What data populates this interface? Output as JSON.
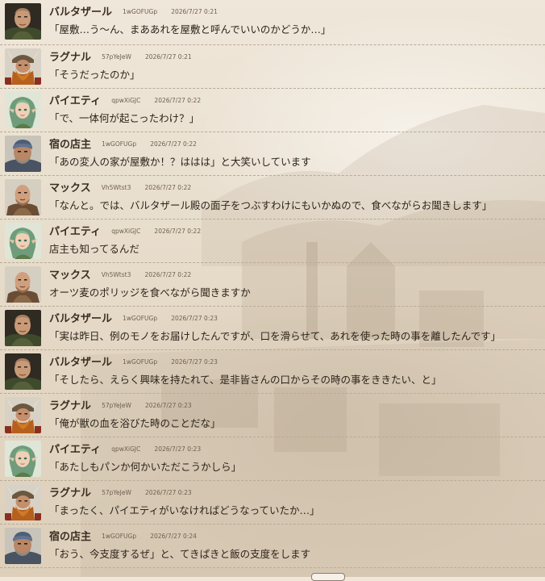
{
  "messages": [
    {
      "name": "バルタザール",
      "uid": "1wGOFUGp",
      "time": "2026/7/27 0:21",
      "text": "「屋敷…う～ん、まああれを屋敷と呼んでいいのかどうか…」",
      "avatar": "baltazar"
    },
    {
      "name": "ラグナル",
      "uid": "57pYeJeW",
      "time": "2026/7/27 0:21",
      "text": "「そうだったのか」",
      "avatar": "ragnar"
    },
    {
      "name": "パイエティ",
      "uid": "qpwXiGJC",
      "time": "2026/7/27 0:22",
      "text": "「で、一体何が起こったわけ？」",
      "avatar": "piety"
    },
    {
      "name": "宿の店主",
      "uid": "1wGOFUGp",
      "time": "2026/7/27 0:22",
      "text": "「あの変人の家が屋敷か！？ははは」と大笑いしています",
      "avatar": "innkeeper"
    },
    {
      "name": "マックス",
      "uid": "Vh5Wtst3",
      "time": "2026/7/27 0:22",
      "text": "「なんと。では、バルタザール殿の面子をつぶすわけにもいかぬので、食べながらお聞きします」",
      "avatar": "max"
    },
    {
      "name": "パイエティ",
      "uid": "qpwXiGJC",
      "time": "2026/7/27 0:22",
      "text": "店主も知ってるんだ",
      "avatar": "piety"
    },
    {
      "name": "マックス",
      "uid": "Vh5Wtst3",
      "time": "2026/7/27 0:22",
      "text": "オーツ麦のポリッジを食べながら聞きますか",
      "avatar": "max"
    },
    {
      "name": "バルタザール",
      "uid": "1wGOFUGp",
      "time": "2026/7/27 0:23",
      "text": "「実は昨日、例のモノをお届けしたんですが、口を滑らせて、あれを使った時の事を離したんです」",
      "avatar": "baltazar"
    },
    {
      "name": "バルタザール",
      "uid": "1wGOFUGp",
      "time": "2026/7/27 0:23",
      "text": "「そしたら、えらく興味を持たれて、是非皆さんの口からその時の事をききたい、と」",
      "avatar": "baltazar"
    },
    {
      "name": "ラグナル",
      "uid": "57pYeJeW",
      "time": "2026/7/27 0:23",
      "text": "「俺が獣の血を浴びた時のことだな」",
      "avatar": "ragnar"
    },
    {
      "name": "パイエティ",
      "uid": "qpwXiGJC",
      "time": "2026/7/27 0:23",
      "text": "「あたしもパンか何かいただこうかしら」",
      "avatar": "piety"
    },
    {
      "name": "ラグナル",
      "uid": "57pYeJeW",
      "time": "2026/7/27 0:23",
      "text": "「まったく、パイエティがいなければどうなっていたか…」",
      "avatar": "ragnar"
    },
    {
      "name": "宿の店主",
      "uid": "1wGOFUGp",
      "time": "2026/7/27 0:24",
      "text": "「おう、今支度するぜ」と、てきぱきと飯の支度をします",
      "avatar": "innkeeper"
    }
  ]
}
